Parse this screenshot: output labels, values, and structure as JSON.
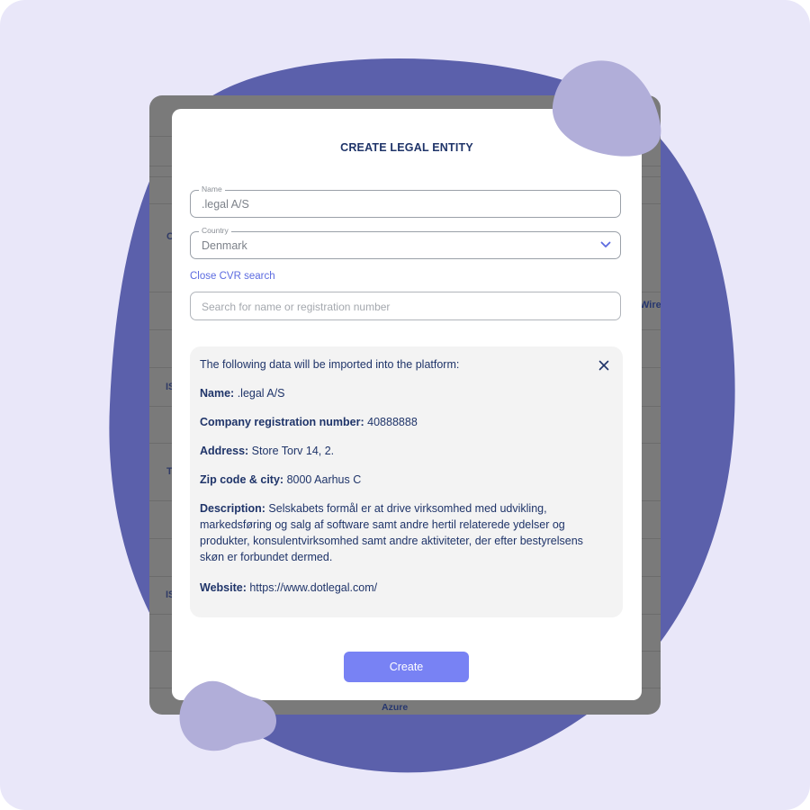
{
  "modal": {
    "title": "CREATE LEGAL ENTITY",
    "name_field": {
      "legend": "Name",
      "value": ".legal A/S"
    },
    "country_field": {
      "legend": "Country",
      "value": "Denmark"
    },
    "close_cvr_label": "Close CVR search",
    "search": {
      "placeholder": "Search for name or registration number"
    },
    "import_panel": {
      "intro": "The following data will be imported into the platform:",
      "rows": [
        {
          "label": "Name:",
          "value": ".legal A/S"
        },
        {
          "label": "Company registration number:",
          "value": "40888888"
        },
        {
          "label": "Address:",
          "value": "Store Torv 14, 2."
        },
        {
          "label": "Zip code & city:",
          "value": "8000 Aarhus C"
        },
        {
          "label": "Description:",
          "value": "Selskabets formål er at drive virksomhed med udvikling, markedsføring og salg af software samt andre hertil relaterede ydelser og produkter, konsulentvirksomhed samt andre aktiviteter, der efter bestyrelsens skøn er forbundet dermed."
        },
        {
          "label": "Website:",
          "value": "https://www.dotlegal.com/"
        }
      ]
    },
    "create_label": "Create"
  },
  "background": {
    "fragments": [
      "C",
      "IS",
      "T",
      "IS",
      "Wirel",
      "Azure"
    ]
  },
  "icons": {
    "country_dropdown": "chevron-down-icon",
    "panel_close": "close-icon"
  },
  "colors": {
    "canvas": "#e9e7f9",
    "blob": "#5b60ab",
    "blob_light": "#b1aed9",
    "accent_button": "#7882f4",
    "link": "#5c6be0",
    "text_navy": "#1f3469"
  }
}
